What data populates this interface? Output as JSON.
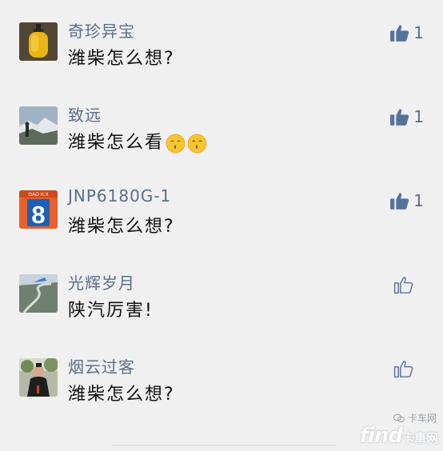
{
  "comments": [
    {
      "name": "奇珍异宝",
      "text": "潍柴怎么想?",
      "likes": "1",
      "liked": true,
      "avatar_icon": "amber-pendant-avatar"
    },
    {
      "name": "致远",
      "text": "潍柴怎么看",
      "likes": "1",
      "liked": true,
      "avatar_icon": "mountain-landscape-avatar",
      "emojis": [
        "kissing-face-emoji",
        "kissing-face-emoji"
      ]
    },
    {
      "name": "JNP6180G-1",
      "text": "潍柴怎么想?",
      "likes": "1",
      "liked": true,
      "avatar_icon": "bus-route-8-avatar",
      "avatar_caption": "GAO H.X",
      "avatar_number": "8"
    },
    {
      "name": "光辉岁月",
      "text": "陕汽厉害!",
      "likes": "",
      "liked": false,
      "avatar_icon": "aerial-road-avatar"
    },
    {
      "name": "烟云过客",
      "text": "潍柴怎么想?",
      "likes": "",
      "liked": false,
      "avatar_icon": "person-outdoor-avatar"
    }
  ],
  "watermark": {
    "top": "卡车网",
    "main": "find",
    "main_cn": "卡車网"
  },
  "colors": {
    "name": "#5a6e8c",
    "liked_thumb": "#57719d",
    "text": "#111111",
    "background": "#f0f0f0"
  }
}
